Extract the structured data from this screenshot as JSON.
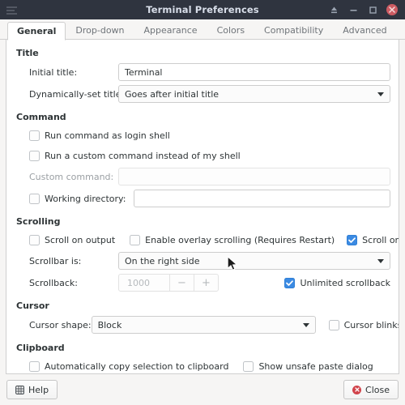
{
  "window": {
    "title": "Terminal Preferences",
    "titlebar_buttons": [
      {
        "name": "shade-icon",
        "glyph": "⏏"
      },
      {
        "name": "minimize-icon",
        "glyph": "–"
      },
      {
        "name": "maximize-icon",
        "glyph": "□"
      },
      {
        "name": "close-icon",
        "glyph": "✕"
      }
    ],
    "colors": {
      "titlebar_bg": "#2f343f",
      "titlebar_fg": "#d8dee9",
      "close_btn": "#cc5b62",
      "accent_check": "#3b8ae2",
      "panel_bg": "#ffffff",
      "window_bg": "#f6f5f4",
      "border": "#cfcfcf",
      "close_red": "#d1434b"
    }
  },
  "tabs": [
    {
      "label": "General",
      "active": true
    },
    {
      "label": "Drop-down",
      "active": false
    },
    {
      "label": "Appearance",
      "active": false
    },
    {
      "label": "Colors",
      "active": false
    },
    {
      "label": "Compatibility",
      "active": false
    },
    {
      "label": "Advanced",
      "active": false
    }
  ],
  "sections": {
    "title": {
      "heading": "Title",
      "initial_title_label": "Initial title:",
      "initial_title_value": "Terminal",
      "initial_title_placeholder": "",
      "dynamic_title_label": "Dynamically-set title:",
      "dynamic_title_value": "Goes after initial title"
    },
    "command": {
      "heading": "Command",
      "login_shell_label": "Run command as login shell",
      "login_shell_checked": false,
      "custom_command_cb_label": "Run a custom command instead of my shell",
      "custom_command_cb_checked": false,
      "custom_command_label": "Custom command:",
      "custom_command_value": "",
      "custom_command_placeholder": "",
      "working_directory_label": "Working directory:",
      "working_directory_checked": false,
      "working_directory_value": "",
      "working_directory_placeholder": ""
    },
    "scrolling": {
      "heading": "Scrolling",
      "scroll_on_output_label": "Scroll on output",
      "scroll_on_output_checked": false,
      "overlay_scrolling_label": "Enable overlay scrolling (Requires Restart)",
      "overlay_scrolling_checked": false,
      "scroll_on_keystroke_label": "Scroll on keystroke",
      "scroll_on_keystroke_checked": true,
      "scrollbar_is_label": "Scrollbar is:",
      "scrollbar_is_value": "On the right side",
      "scrollback_label": "Scrollback:",
      "scrollback_value": "1000",
      "scrollback_minus": "−",
      "scrollback_plus": "+",
      "unlimited_scrollback_label": "Unlimited scrollback",
      "unlimited_scrollback_checked": true
    },
    "cursor": {
      "heading": "Cursor",
      "cursor_shape_label": "Cursor shape:",
      "cursor_shape_value": "Block",
      "cursor_blinks_label": "Cursor blinks",
      "cursor_blinks_checked": false
    },
    "clipboard": {
      "heading": "Clipboard",
      "auto_copy_label": "Automatically copy selection to clipboard",
      "auto_copy_checked": false,
      "unsafe_paste_label": "Show unsafe paste dialog",
      "unsafe_paste_checked": false
    }
  },
  "actions": {
    "help_label": "Help",
    "close_label": "Close"
  }
}
